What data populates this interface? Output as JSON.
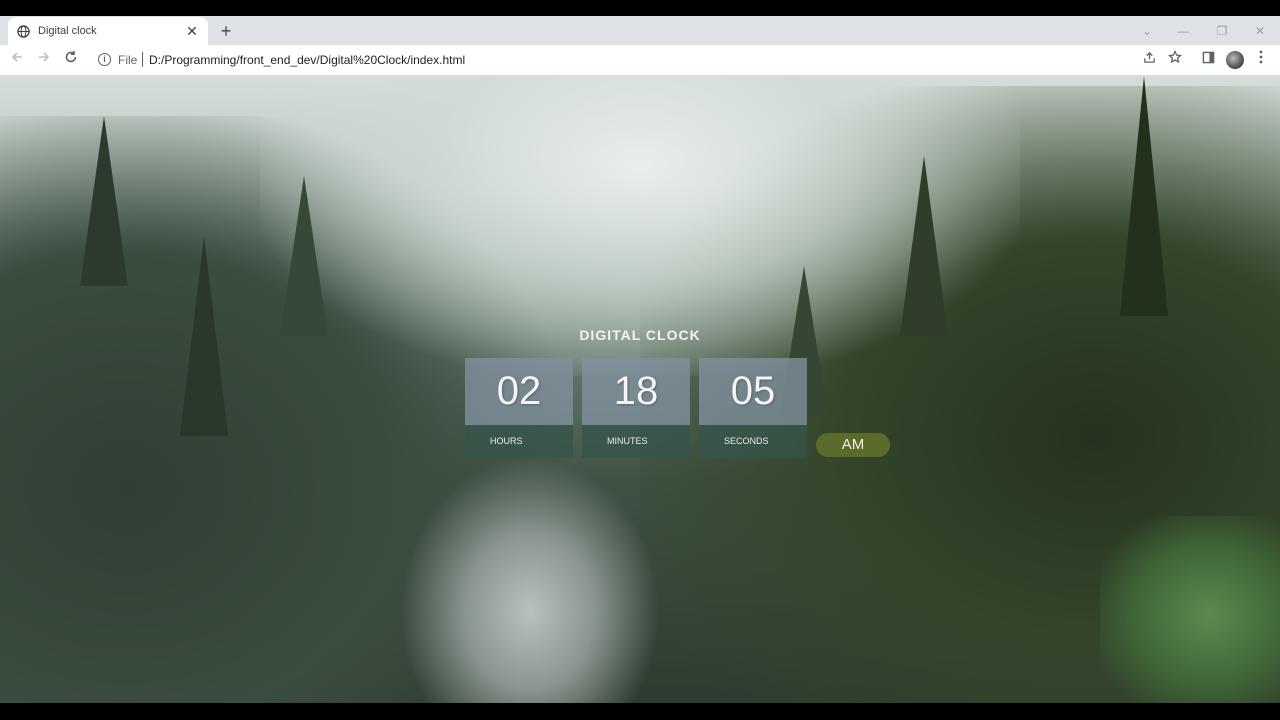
{
  "browser": {
    "tab_title": "Digital clock",
    "tab_close": "✕",
    "new_tab": "+",
    "scheme": "File",
    "url": "D:/Programming/front_end_dev/Digital%20Clock/index.html",
    "controls": {
      "dropdown": "⌄",
      "minimize": "—",
      "restore": "❐",
      "close": "✕"
    }
  },
  "clock": {
    "title": "DIGITAL CLOCK",
    "hours": "02",
    "minutes": "18",
    "seconds": "05",
    "hours_label": "HOURS",
    "minutes_label": "MINUTES",
    "seconds_label": "SECONDS",
    "period": "AM",
    "colors": {
      "digit_panel": "#8291a0",
      "label_panel": "#37554b",
      "period_badge": "#5a6b2a"
    }
  }
}
